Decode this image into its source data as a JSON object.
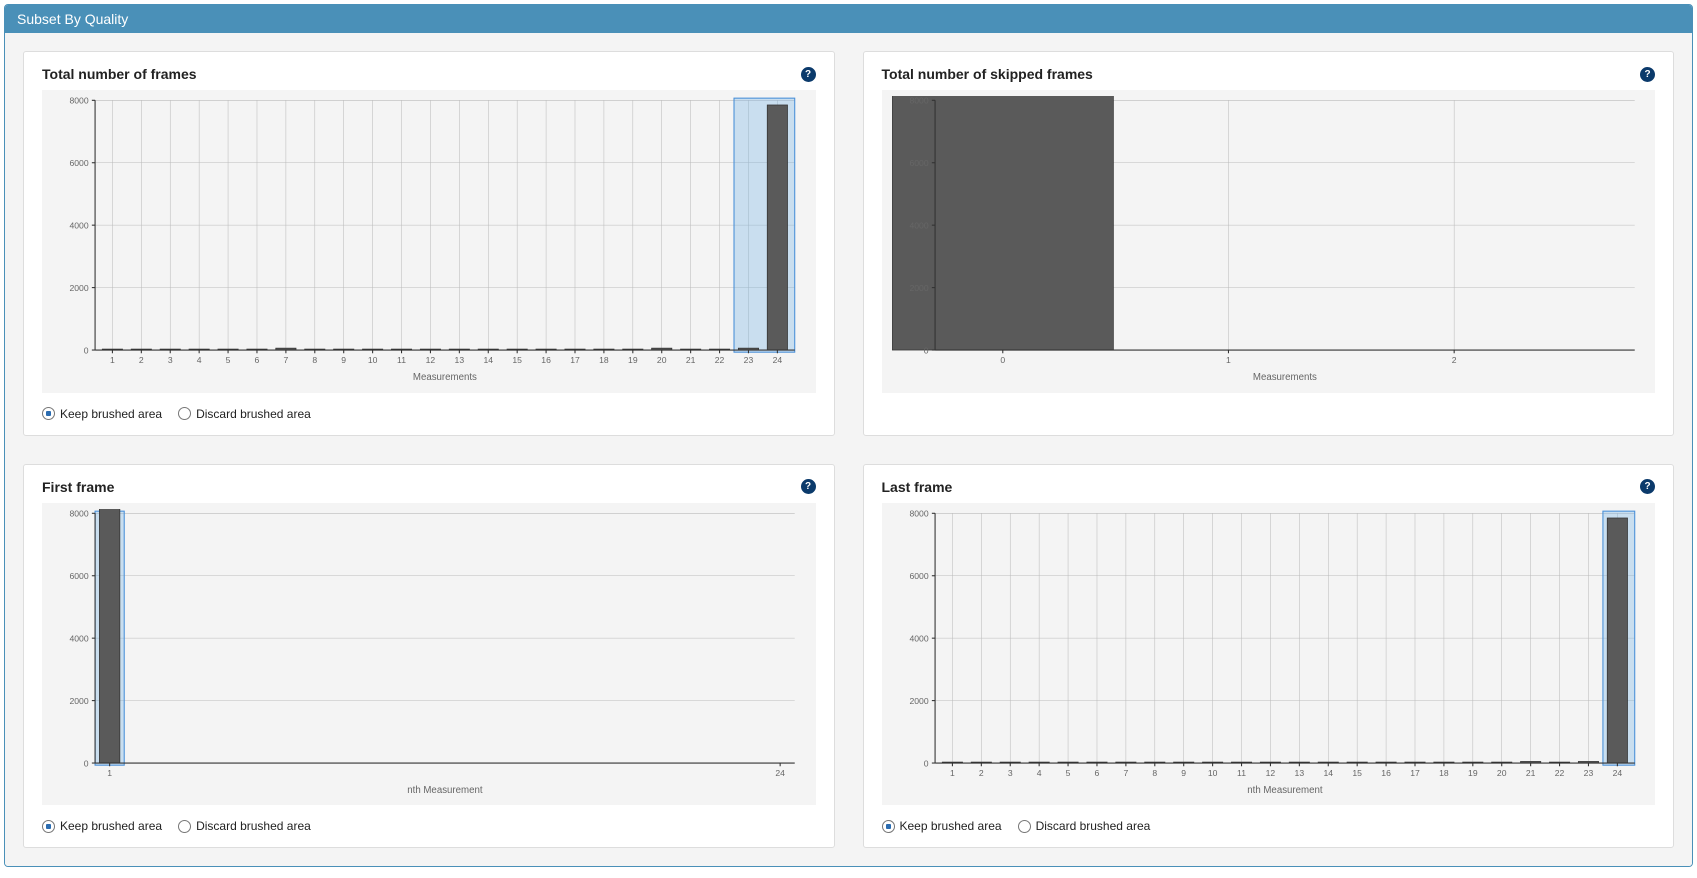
{
  "panel": {
    "title": "Subset By Quality"
  },
  "radio_labels": {
    "keep": "Keep brushed area",
    "discard": "Discard brushed area"
  },
  "cards": [
    {
      "id": "total-frames",
      "title": "Total number of frames",
      "has_radio": true,
      "brush_mode": "keep",
      "brush_range": [
        22.5,
        24.6
      ]
    },
    {
      "id": "skipped-frames",
      "title": "Total number of skipped frames",
      "has_radio": false
    },
    {
      "id": "first-frame",
      "title": "First frame",
      "has_radio": true,
      "brush_mode": "keep",
      "brush_range": [
        0.5,
        1.5
      ]
    },
    {
      "id": "last-frame",
      "title": "Last frame",
      "has_radio": true,
      "brush_mode": "keep",
      "brush_range": [
        23.5,
        24.6
      ]
    }
  ],
  "chart_data": [
    {
      "id": "total-frames",
      "type": "bar",
      "title": "Total number of frames",
      "xlabel": "Measurements",
      "ylabel": "",
      "ylim": [
        0,
        8000
      ],
      "yticks": [
        0,
        2000,
        4000,
        6000,
        8000
      ],
      "categories": [
        1,
        2,
        3,
        4,
        5,
        6,
        7,
        8,
        9,
        10,
        11,
        12,
        13,
        14,
        15,
        16,
        17,
        18,
        19,
        20,
        21,
        22,
        23,
        24
      ],
      "values": [
        30,
        30,
        30,
        30,
        30,
        30,
        60,
        30,
        30,
        30,
        30,
        30,
        30,
        30,
        30,
        30,
        30,
        30,
        30,
        60,
        30,
        30,
        60,
        7850
      ]
    },
    {
      "id": "skipped-frames",
      "type": "bar",
      "title": "Total number of skipped frames",
      "xlabel": "Measurements",
      "ylabel": "",
      "ylim": [
        0,
        8000
      ],
      "yticks": [
        0,
        2000,
        4000,
        6000,
        8000
      ],
      "categories": [
        0,
        1,
        2
      ],
      "values": [
        8500,
        0,
        0
      ],
      "bar_width_frac": 0.98,
      "xlim": [
        -0.3,
        2.8
      ]
    },
    {
      "id": "first-frame",
      "type": "bar",
      "title": "First frame",
      "xlabel": "nth Measurement",
      "ylabel": "",
      "ylim": [
        0,
        8000
      ],
      "yticks": [
        0,
        2000,
        4000,
        6000,
        8000
      ],
      "categories": [
        1,
        24
      ],
      "values": [
        8500,
        0
      ],
      "xlim": [
        0.5,
        24.5
      ],
      "xticks": [
        1,
        24
      ]
    },
    {
      "id": "last-frame",
      "type": "bar",
      "title": "Last frame",
      "xlabel": "nth Measurement",
      "ylabel": "",
      "ylim": [
        0,
        8000
      ],
      "yticks": [
        0,
        2000,
        4000,
        6000,
        8000
      ],
      "categories": [
        1,
        2,
        3,
        4,
        5,
        6,
        7,
        8,
        9,
        10,
        11,
        12,
        13,
        14,
        15,
        16,
        17,
        18,
        19,
        20,
        21,
        22,
        23,
        24
      ],
      "values": [
        30,
        30,
        30,
        30,
        30,
        30,
        30,
        30,
        30,
        30,
        30,
        30,
        30,
        30,
        30,
        30,
        30,
        30,
        30,
        30,
        50,
        30,
        50,
        7850
      ]
    }
  ]
}
